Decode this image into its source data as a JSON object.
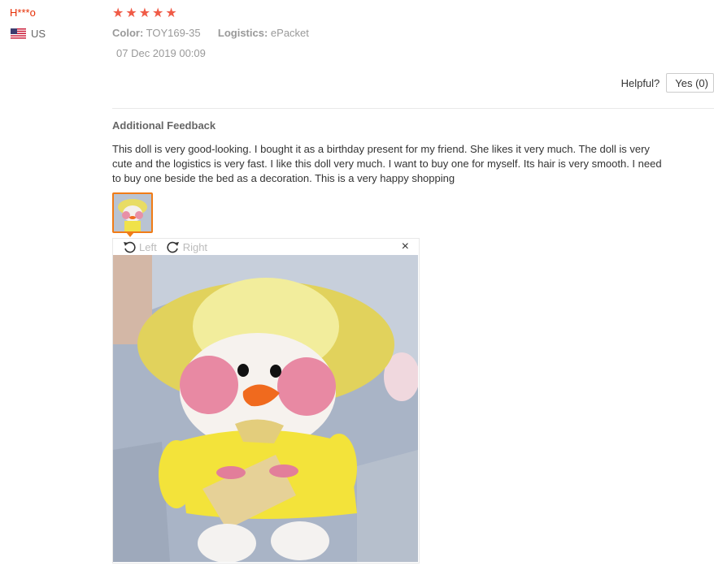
{
  "review": {
    "user_name": "H***o",
    "country": "US",
    "rating": 5,
    "color_label": "Color:",
    "color_value": "TOY169-35",
    "logistics_label": "Logistics:",
    "logistics_value": "ePacket",
    "date": "07 Dec 2019 00:09",
    "helpful_label": "Helpful?",
    "helpful_yes": "Yes (0)",
    "feedback_title": "Additional Feedback",
    "feedback_text": "This doll is very good-looking. I bought it as a birthday present for my friend. She likes it very much. The doll is very cute and the logistics is very fast. I like this doll very much. I want to buy one for myself. Its hair is very smooth. I need to buy one beside the bed as a decoration. This is a very happy shopping"
  },
  "viewer": {
    "rotate_left_label": "Left",
    "rotate_right_label": "Right",
    "close_symbol": "×"
  },
  "colors": {
    "star": "#f05b47",
    "user_name": "#e62e04",
    "thumb_border": "#f07c17"
  },
  "icons": [
    "us-flag-icon",
    "star-icon",
    "rotate-left-icon",
    "rotate-right-icon",
    "close-icon"
  ]
}
